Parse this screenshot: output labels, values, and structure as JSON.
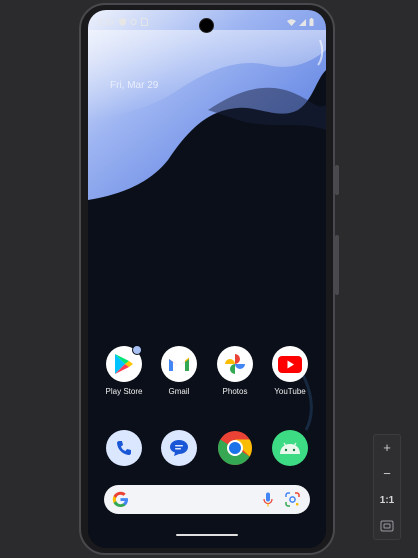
{
  "status_bar": {
    "time": "5:20",
    "left_icons": [
      "shield-icon",
      "sync-icon",
      "sim-icon"
    ],
    "right_icons": [
      "wifi-icon",
      "signal-icon",
      "battery-icon"
    ]
  },
  "home": {
    "date": "Fri, Mar 29",
    "apps_row1": [
      {
        "label": "Play Store",
        "icon": "play-store-icon"
      },
      {
        "label": "Gmail",
        "icon": "gmail-icon"
      },
      {
        "label": "Photos",
        "icon": "photos-icon"
      },
      {
        "label": "YouTube",
        "icon": "youtube-icon"
      }
    ],
    "dock": [
      {
        "icon": "phone-icon"
      },
      {
        "icon": "messages-icon"
      },
      {
        "icon": "chrome-icon"
      },
      {
        "icon": "android-icon"
      }
    ],
    "search_bar": {
      "icons": [
        "google-icon",
        "mic-icon",
        "lens-icon"
      ]
    }
  },
  "emulator_controls": {
    "zoom_in": "+",
    "zoom_out": "−",
    "actual_size": "1:1",
    "fit": "fit-screen-icon"
  },
  "colors": {
    "background": "#2b2b2d",
    "wallpaper_blue": "#7f9ef0",
    "wallpaper_dark": "#0b0f19"
  }
}
